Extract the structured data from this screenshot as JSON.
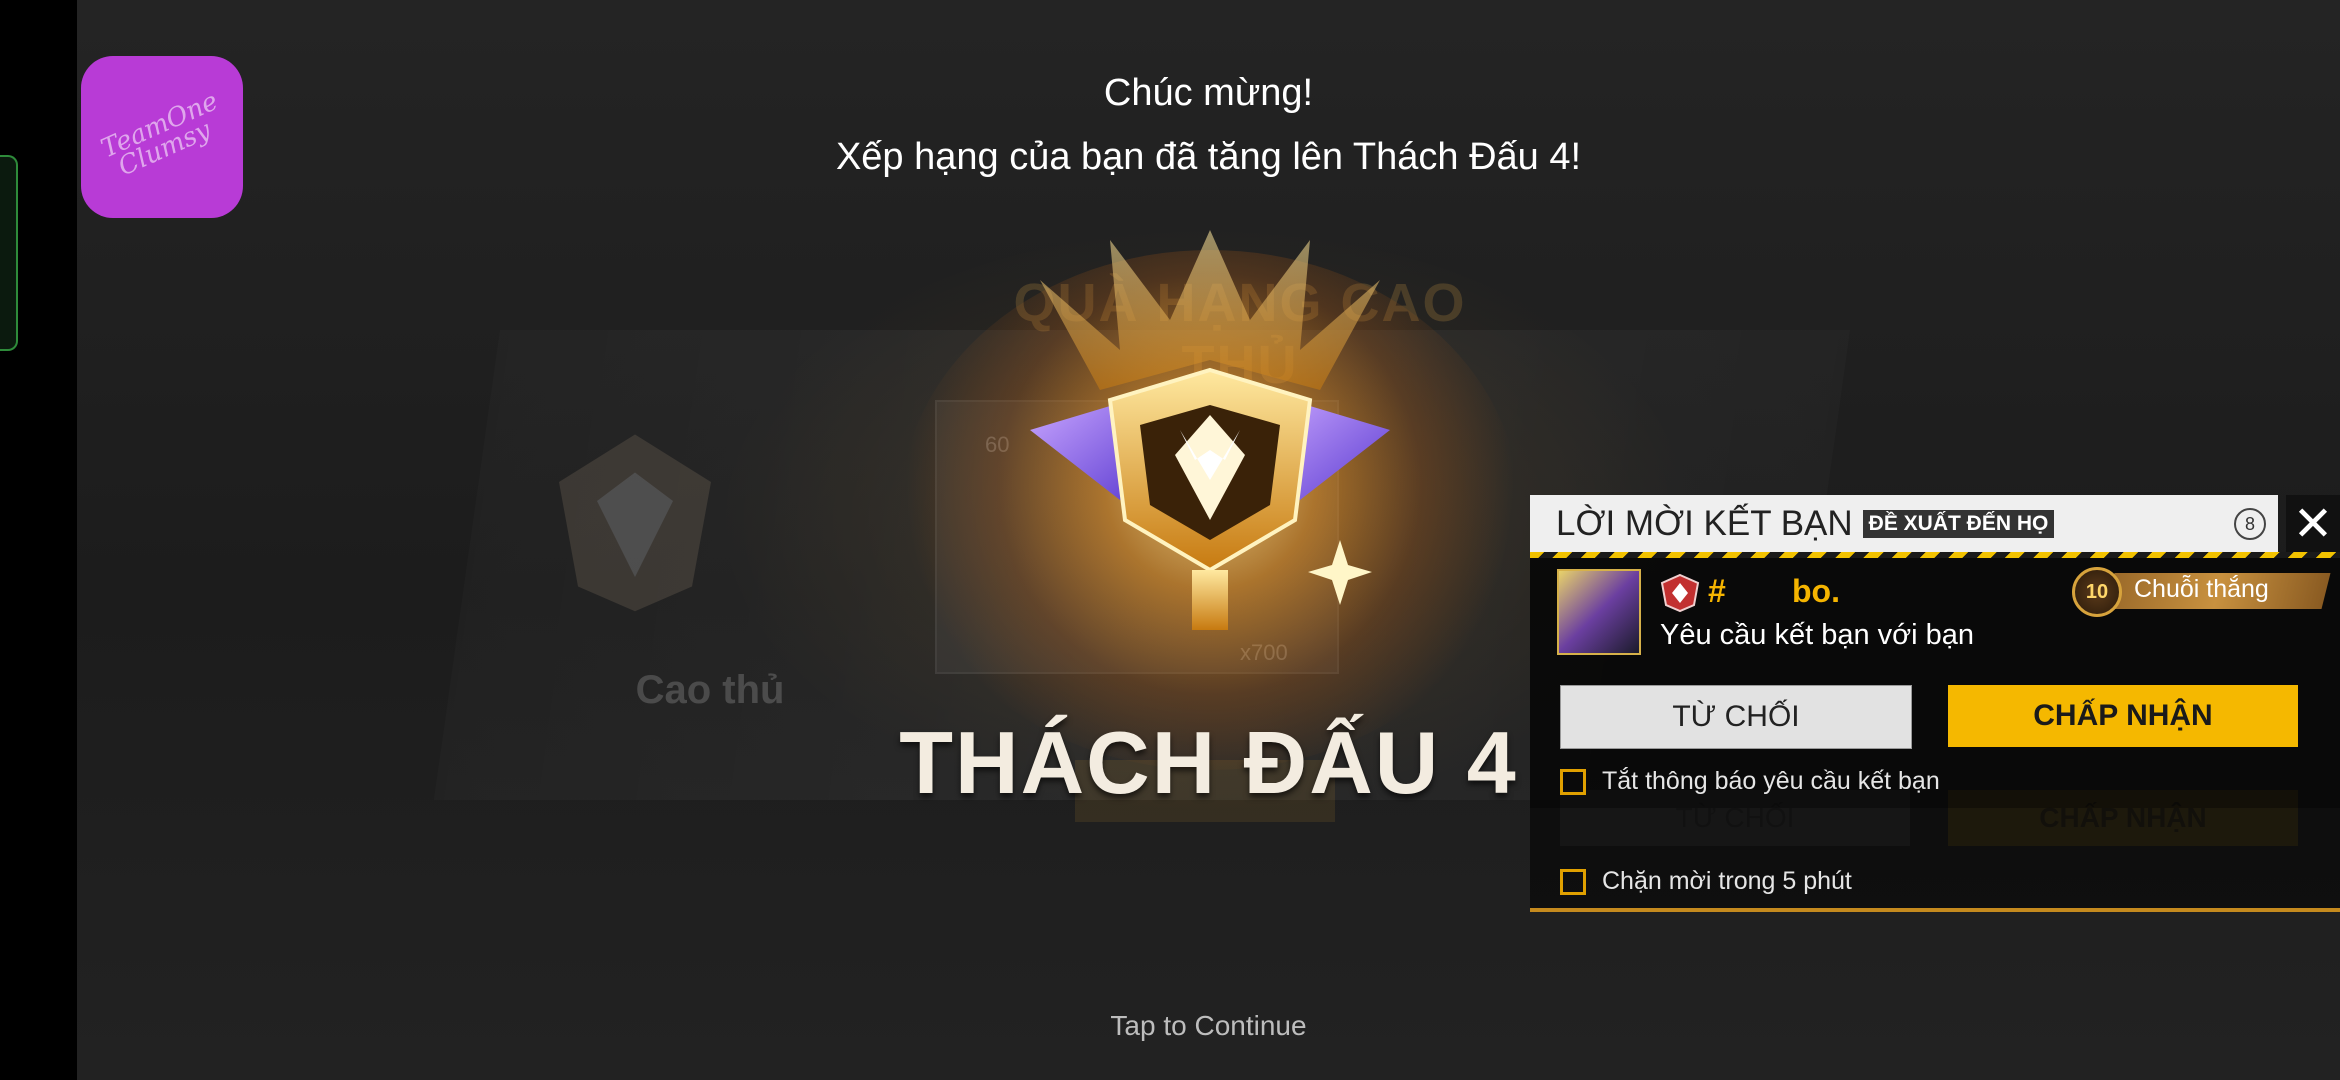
{
  "app_icon": {
    "text_line1": "TeamOne",
    "text_line2": "Clumsy"
  },
  "congrats": {
    "line1": "Chúc mừng!",
    "line2": "Xếp hạng của bạn đã tăng lên Thách Đấu 4!"
  },
  "background": {
    "title": "QUÀ HẠNG CAO THỦ",
    "rank_label": "Cao thủ",
    "card_top": "60",
    "card_amount": "x700"
  },
  "rank": {
    "title": "THÁCH ĐẤU 4"
  },
  "footer": {
    "tap": "Tap to Continue"
  },
  "friend_request": {
    "title": "LỜI MỜI KẾT BẠN",
    "subtitle": "ĐỀ XUẤT ĐẾN HỌ",
    "count": "8",
    "close_icon": "close-icon",
    "player": {
      "hash": "#",
      "name": "bo.",
      "message": "Yêu cầu kết bạn với bạn"
    },
    "streak": {
      "number": "10",
      "label": "Chuỗi thắng"
    },
    "decline_label": "TỪ CHỐI",
    "accept_label": "CHẤP NHẬN",
    "mute_label": "Tắt thông báo yêu cầu kết bạn",
    "block_label": "Chặn mời trong 5 phút"
  },
  "colors": {
    "accent": "#f5b800",
    "app_icon": "#b83bd6",
    "name": "#f5b400"
  }
}
